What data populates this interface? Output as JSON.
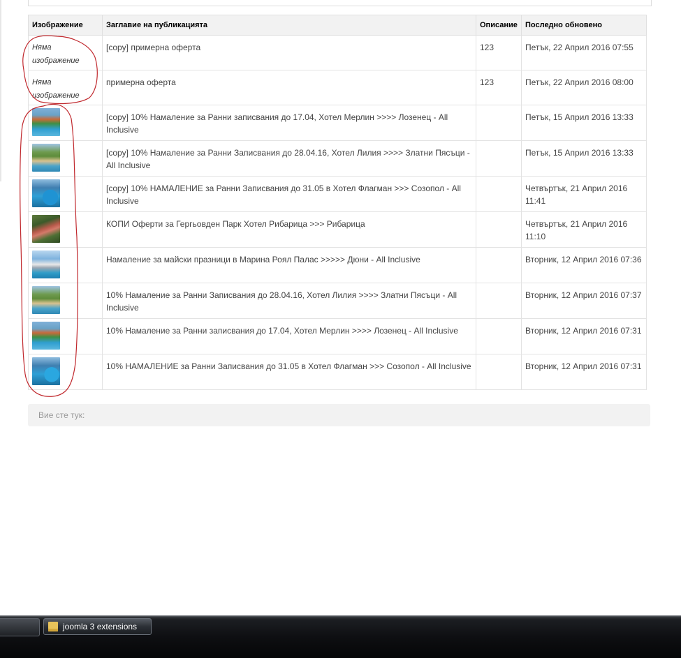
{
  "table": {
    "headers": {
      "image": "Изображение",
      "title": "Заглавие на публикацията",
      "description": "Описание",
      "updated": "Последно обновено"
    },
    "rows": [
      {
        "image": "Няма изображение",
        "thumb": null,
        "title": "[copy] примерна оферта",
        "description": "123",
        "updated": "Петък, 22 Април 2016 07:55"
      },
      {
        "image": "Няма изображение",
        "thumb": null,
        "title": "примерна оферта",
        "description": "123",
        "updated": "Петък, 22 Април 2016 08:00"
      },
      {
        "image": "",
        "thumb": "hotel-merlin-thumbnail",
        "title": "[copy] 10% Намаление за Ранни записвания до 17.04, Хотел Мерлин >>>> Лозенец - All Inclusive",
        "description": "",
        "updated": "Петък, 15 Април 2016 13:33"
      },
      {
        "image": "",
        "thumb": "hotel-lilia-thumbnail",
        "title": "[copy] 10% Намаление за Ранни Записвания до 28.04.16, Хотел Лилия >>>> Златни Пясъци - All Inclusive",
        "description": "",
        "updated": "Петък, 15 Април 2016 13:33"
      },
      {
        "image": "",
        "thumb": "hotel-flagman-thumbnail",
        "title": "[copy] 10% НАМАЛЕНИЕ за Ранни Записвания до 31.05 в Хотел Флагман >>> Созопол - All Inclusive",
        "description": "",
        "updated": "Четвъртък, 21 Април 2016 11:41"
      },
      {
        "image": "",
        "thumb": "park-hotel-ribaritsa-thumbnail",
        "title": "КОПИ Оферти за Гергьовден Парк Хотел Рибарица >>> Рибарица",
        "description": "",
        "updated": "Четвъртък, 21 Април 2016 11:10"
      },
      {
        "image": "",
        "thumb": "marina-royal-palace-thumbnail",
        "title": "Намаление за майски празници в Марина Роял Палас >>>>> Дюни - All Inclusive",
        "description": "",
        "updated": "Вторник, 12 Април 2016 07:36"
      },
      {
        "image": "",
        "thumb": "hotel-lilia-thumbnail",
        "title": "10% Намаление за Ранни Записвания до 28.04.16, Хотел Лилия >>>> Златни Пясъци - All Inclusive",
        "description": "",
        "updated": "Вторник, 12 Април 2016 07:37"
      },
      {
        "image": "",
        "thumb": "hotel-merlin-thumbnail",
        "title": "10% Намаление за Ранни записвания до 17.04, Хотел Мерлин >>>> Лозенец - All Inclusive",
        "description": "",
        "updated": "Вторник, 12 Април 2016 07:31"
      },
      {
        "image": "",
        "thumb": "hotel-flagman-thumbnail",
        "title": "10% НАМАЛЕНИЕ за Ранни Записвания до 31.05 в Хотел Флагман >>> Созопол - All Inclusive",
        "description": "",
        "updated": "Вторник, 12 Април 2016 07:31"
      }
    ]
  },
  "breadcrumb": {
    "label": "Вие сте тук:"
  },
  "taskbar": {
    "window_button_label": "joomla 3 extensions",
    "window_icon": "folder-icon"
  },
  "annotation_color": "#c0282d"
}
